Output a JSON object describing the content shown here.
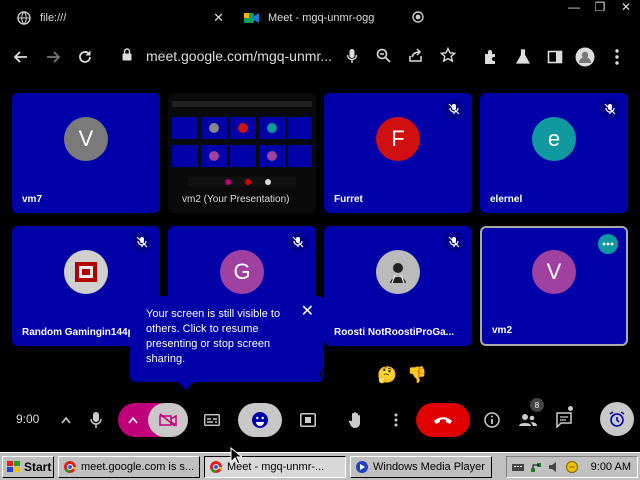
{
  "browser": {
    "tabs": [
      {
        "title": "file:///",
        "close": "✕"
      },
      {
        "title": "Meet - mgq-unmr-ogg",
        "close": "✕"
      }
    ],
    "url": "meet.google.com/mgq-unmr..."
  },
  "tiles": [
    {
      "name": "vm7",
      "initial": "V",
      "avatar_color": "#7a7a7a"
    },
    {
      "name": "vm2 (Your Presentation)"
    },
    {
      "name": "Furret",
      "initial": "F",
      "avatar_color": "#d01010"
    },
    {
      "name": "elernel",
      "initial": "e",
      "avatar_color": "#109aa0"
    },
    {
      "name": "Random Gamingin144p"
    },
    {
      "name": "G",
      "initial": "G",
      "avatar_color": "#a040a0"
    },
    {
      "name": "Roosti NotRoostiProGa..."
    },
    {
      "name": "vm2",
      "initial": "V",
      "avatar_color": "#a040a0"
    }
  ],
  "tooltip": {
    "text": "Your screen is still visible to others. Click to resume presenting or stop screen sharing.",
    "close": "✕"
  },
  "reactions": [
    "😮",
    "😢",
    "🤔",
    "👎"
  ],
  "controls": {
    "time": "9:00",
    "people_count": "8"
  },
  "taskbar": {
    "start": "Start",
    "tasks": [
      "meet.google.com is s...",
      "Meet - mgq-unmr-...",
      "Windows Media Player"
    ],
    "clock": "9:00 AM"
  },
  "colors": {
    "tile_bg": "#0000a8",
    "leave_button": "#e00000",
    "camera_button": "#c0007a"
  }
}
